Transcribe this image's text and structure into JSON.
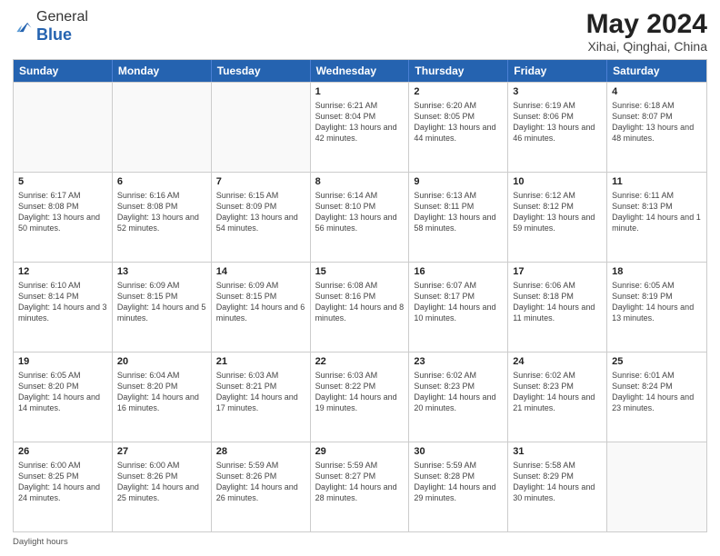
{
  "logo": {
    "general": "General",
    "blue": "Blue"
  },
  "header": {
    "month": "May 2024",
    "location": "Xihai, Qinghai, China"
  },
  "days": [
    "Sunday",
    "Monday",
    "Tuesday",
    "Wednesday",
    "Thursday",
    "Friday",
    "Saturday"
  ],
  "rows": [
    [
      {
        "day": "",
        "sunrise": "",
        "sunset": "",
        "daylight": ""
      },
      {
        "day": "",
        "sunrise": "",
        "sunset": "",
        "daylight": ""
      },
      {
        "day": "",
        "sunrise": "",
        "sunset": "",
        "daylight": ""
      },
      {
        "day": "1",
        "sunrise": "Sunrise: 6:21 AM",
        "sunset": "Sunset: 8:04 PM",
        "daylight": "Daylight: 13 hours and 42 minutes."
      },
      {
        "day": "2",
        "sunrise": "Sunrise: 6:20 AM",
        "sunset": "Sunset: 8:05 PM",
        "daylight": "Daylight: 13 hours and 44 minutes."
      },
      {
        "day": "3",
        "sunrise": "Sunrise: 6:19 AM",
        "sunset": "Sunset: 8:06 PM",
        "daylight": "Daylight: 13 hours and 46 minutes."
      },
      {
        "day": "4",
        "sunrise": "Sunrise: 6:18 AM",
        "sunset": "Sunset: 8:07 PM",
        "daylight": "Daylight: 13 hours and 48 minutes."
      }
    ],
    [
      {
        "day": "5",
        "sunrise": "Sunrise: 6:17 AM",
        "sunset": "Sunset: 8:08 PM",
        "daylight": "Daylight: 13 hours and 50 minutes."
      },
      {
        "day": "6",
        "sunrise": "Sunrise: 6:16 AM",
        "sunset": "Sunset: 8:08 PM",
        "daylight": "Daylight: 13 hours and 52 minutes."
      },
      {
        "day": "7",
        "sunrise": "Sunrise: 6:15 AM",
        "sunset": "Sunset: 8:09 PM",
        "daylight": "Daylight: 13 hours and 54 minutes."
      },
      {
        "day": "8",
        "sunrise": "Sunrise: 6:14 AM",
        "sunset": "Sunset: 8:10 PM",
        "daylight": "Daylight: 13 hours and 56 minutes."
      },
      {
        "day": "9",
        "sunrise": "Sunrise: 6:13 AM",
        "sunset": "Sunset: 8:11 PM",
        "daylight": "Daylight: 13 hours and 58 minutes."
      },
      {
        "day": "10",
        "sunrise": "Sunrise: 6:12 AM",
        "sunset": "Sunset: 8:12 PM",
        "daylight": "Daylight: 13 hours and 59 minutes."
      },
      {
        "day": "11",
        "sunrise": "Sunrise: 6:11 AM",
        "sunset": "Sunset: 8:13 PM",
        "daylight": "Daylight: 14 hours and 1 minute."
      }
    ],
    [
      {
        "day": "12",
        "sunrise": "Sunrise: 6:10 AM",
        "sunset": "Sunset: 8:14 PM",
        "daylight": "Daylight: 14 hours and 3 minutes."
      },
      {
        "day": "13",
        "sunrise": "Sunrise: 6:09 AM",
        "sunset": "Sunset: 8:15 PM",
        "daylight": "Daylight: 14 hours and 5 minutes."
      },
      {
        "day": "14",
        "sunrise": "Sunrise: 6:09 AM",
        "sunset": "Sunset: 8:15 PM",
        "daylight": "Daylight: 14 hours and 6 minutes."
      },
      {
        "day": "15",
        "sunrise": "Sunrise: 6:08 AM",
        "sunset": "Sunset: 8:16 PM",
        "daylight": "Daylight: 14 hours and 8 minutes."
      },
      {
        "day": "16",
        "sunrise": "Sunrise: 6:07 AM",
        "sunset": "Sunset: 8:17 PM",
        "daylight": "Daylight: 14 hours and 10 minutes."
      },
      {
        "day": "17",
        "sunrise": "Sunrise: 6:06 AM",
        "sunset": "Sunset: 8:18 PM",
        "daylight": "Daylight: 14 hours and 11 minutes."
      },
      {
        "day": "18",
        "sunrise": "Sunrise: 6:05 AM",
        "sunset": "Sunset: 8:19 PM",
        "daylight": "Daylight: 14 hours and 13 minutes."
      }
    ],
    [
      {
        "day": "19",
        "sunrise": "Sunrise: 6:05 AM",
        "sunset": "Sunset: 8:20 PM",
        "daylight": "Daylight: 14 hours and 14 minutes."
      },
      {
        "day": "20",
        "sunrise": "Sunrise: 6:04 AM",
        "sunset": "Sunset: 8:20 PM",
        "daylight": "Daylight: 14 hours and 16 minutes."
      },
      {
        "day": "21",
        "sunrise": "Sunrise: 6:03 AM",
        "sunset": "Sunset: 8:21 PM",
        "daylight": "Daylight: 14 hours and 17 minutes."
      },
      {
        "day": "22",
        "sunrise": "Sunrise: 6:03 AM",
        "sunset": "Sunset: 8:22 PM",
        "daylight": "Daylight: 14 hours and 19 minutes."
      },
      {
        "day": "23",
        "sunrise": "Sunrise: 6:02 AM",
        "sunset": "Sunset: 8:23 PM",
        "daylight": "Daylight: 14 hours and 20 minutes."
      },
      {
        "day": "24",
        "sunrise": "Sunrise: 6:02 AM",
        "sunset": "Sunset: 8:23 PM",
        "daylight": "Daylight: 14 hours and 21 minutes."
      },
      {
        "day": "25",
        "sunrise": "Sunrise: 6:01 AM",
        "sunset": "Sunset: 8:24 PM",
        "daylight": "Daylight: 14 hours and 23 minutes."
      }
    ],
    [
      {
        "day": "26",
        "sunrise": "Sunrise: 6:00 AM",
        "sunset": "Sunset: 8:25 PM",
        "daylight": "Daylight: 14 hours and 24 minutes."
      },
      {
        "day": "27",
        "sunrise": "Sunrise: 6:00 AM",
        "sunset": "Sunset: 8:26 PM",
        "daylight": "Daylight: 14 hours and 25 minutes."
      },
      {
        "day": "28",
        "sunrise": "Sunrise: 5:59 AM",
        "sunset": "Sunset: 8:26 PM",
        "daylight": "Daylight: 14 hours and 26 minutes."
      },
      {
        "day": "29",
        "sunrise": "Sunrise: 5:59 AM",
        "sunset": "Sunset: 8:27 PM",
        "daylight": "Daylight: 14 hours and 28 minutes."
      },
      {
        "day": "30",
        "sunrise": "Sunrise: 5:59 AM",
        "sunset": "Sunset: 8:28 PM",
        "daylight": "Daylight: 14 hours and 29 minutes."
      },
      {
        "day": "31",
        "sunrise": "Sunrise: 5:58 AM",
        "sunset": "Sunset: 8:29 PM",
        "daylight": "Daylight: 14 hours and 30 minutes."
      },
      {
        "day": "",
        "sunrise": "",
        "sunset": "",
        "daylight": ""
      }
    ]
  ],
  "footer": {
    "label": "Daylight hours"
  }
}
